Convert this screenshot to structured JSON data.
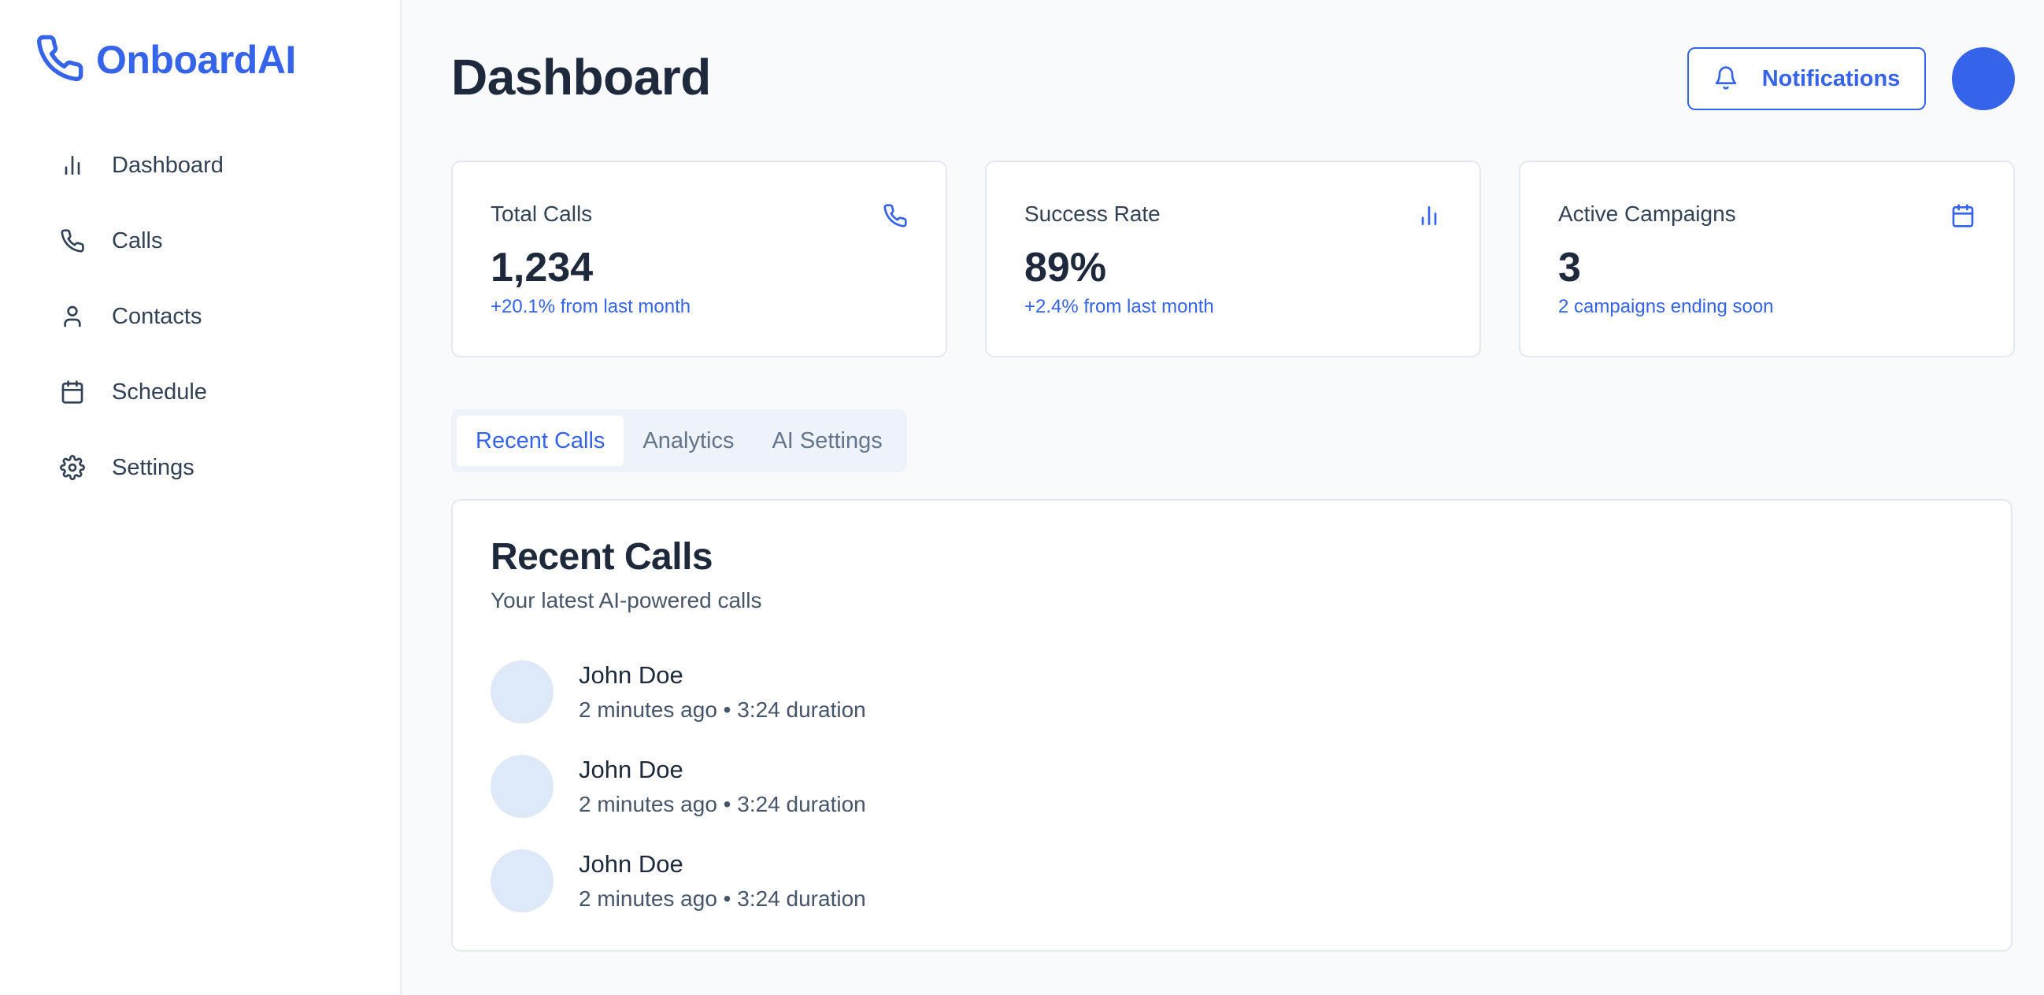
{
  "brand": {
    "name": "OnboardAI",
    "color": "#3563e9"
  },
  "sidebar": {
    "items": [
      {
        "label": "Dashboard",
        "icon": "bar-chart-icon"
      },
      {
        "label": "Calls",
        "icon": "phone-icon"
      },
      {
        "label": "Contacts",
        "icon": "user-icon"
      },
      {
        "label": "Schedule",
        "icon": "calendar-icon"
      },
      {
        "label": "Settings",
        "icon": "gear-icon"
      }
    ]
  },
  "header": {
    "title": "Dashboard",
    "notifications_label": "Notifications"
  },
  "stats": [
    {
      "title": "Total Calls",
      "value": "1,234",
      "sub": "+20.1% from last month",
      "icon": "phone-icon"
    },
    {
      "title": "Success Rate",
      "value": "89%",
      "sub": "+2.4% from last month",
      "icon": "bar-chart-icon"
    },
    {
      "title": "Active Campaigns",
      "value": "3",
      "sub": "2 campaigns ending soon",
      "icon": "calendar-icon"
    }
  ],
  "tabs": [
    {
      "label": "Recent Calls",
      "active": true
    },
    {
      "label": "Analytics",
      "active": false
    },
    {
      "label": "AI Settings",
      "active": false
    }
  ],
  "recent_calls": {
    "title": "Recent Calls",
    "subtitle": "Your latest AI-powered calls",
    "items": [
      {
        "name": "John Doe",
        "meta": "2 minutes ago • 3:24 duration"
      },
      {
        "name": "John Doe",
        "meta": "2 minutes ago • 3:24 duration"
      },
      {
        "name": "John Doe",
        "meta": "2 minutes ago • 3:24 duration"
      }
    ]
  }
}
